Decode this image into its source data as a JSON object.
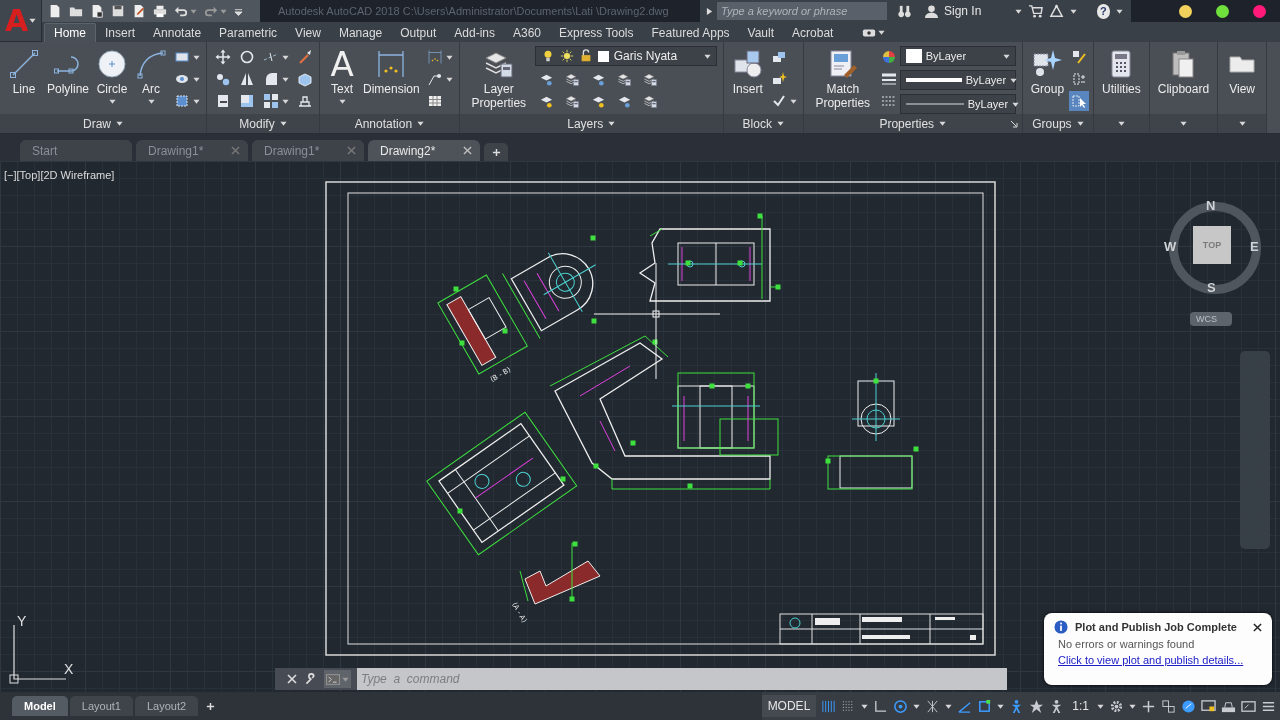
{
  "app_button": {
    "letter": "A"
  },
  "quick_access": [
    {
      "menu": false
    },
    {
      "menu": false
    },
    {
      "menu": false
    },
    {
      "menu": false
    },
    {
      "menu": false
    },
    {
      "menu": false
    },
    {
      "menu": true
    },
    {
      "menu": true
    }
  ],
  "title": "Autodesk AutoCAD 2018    C:\\Users\\Administrator\\Documents\\Lati    \\Drawing2.dwg",
  "search": {
    "placeholder": "Type a keyword or phrase"
  },
  "sign_in": "Sign In",
  "help": "?",
  "window_buttons": [
    {
      "color": "#f2d15c"
    },
    {
      "color": "#6fe03c"
    },
    {
      "color": "#ff1a7a"
    }
  ],
  "ribbon_tabs": [
    {
      "label": "Home",
      "selected": true
    },
    {
      "label": "Insert",
      "selected": false
    },
    {
      "label": "Annotate",
      "selected": false
    },
    {
      "label": "Parametric",
      "selected": false
    },
    {
      "label": "View",
      "selected": false
    },
    {
      "label": "Manage",
      "selected": false
    },
    {
      "label": "Output",
      "selected": false
    },
    {
      "label": "Add-ins",
      "selected": false
    },
    {
      "label": "A360",
      "selected": false
    },
    {
      "label": "Express Tools",
      "selected": false
    },
    {
      "label": "Featured Apps",
      "selected": false
    },
    {
      "label": "Vault",
      "selected": false
    },
    {
      "label": "Acrobat",
      "selected": false
    }
  ],
  "ribbon_panels": [
    {
      "title": "Draw",
      "items": [
        {
          "kind": "large",
          "label": "Line",
          "menu": false
        },
        {
          "kind": "large",
          "label": "Polyline",
          "menu": false
        },
        {
          "kind": "large",
          "label": "Circle",
          "menu": true
        },
        {
          "kind": "large",
          "label": "Arc",
          "menu": true
        },
        {
          "kind": "tools",
          "tools": [
            {
              "menu": true
            },
            {
              "menu": true
            },
            {
              "menu": true
            }
          ]
        }
      ]
    },
    {
      "title": "Modify",
      "items": [
        {
          "kind": "tools",
          "tools": [
            {
              "menu": false
            },
            {
              "menu": false
            },
            {
              "menu": false
            },
            {
              "menu": false
            },
            {
              "menu": false
            },
            {
              "menu": false
            },
            {
              "menu": true
            },
            {
              "menu": true
            },
            {
              "menu": true
            },
            {
              "menu": false
            },
            {
              "menu": false
            },
            {
              "menu": false
            }
          ]
        }
      ]
    },
    {
      "title": "Annotation",
      "items": [
        {
          "kind": "large",
          "glyph": "A",
          "label": "Text",
          "menu": true
        },
        {
          "kind": "large",
          "label": "Dimension",
          "menu": false
        },
        {
          "kind": "tools",
          "tools": [
            {
              "menu": true
            },
            {
              "menu": true
            },
            {
              "menu": false
            }
          ]
        }
      ]
    },
    {
      "title": "Layers",
      "items": [
        {
          "kind": "large",
          "label": "Layer Properties",
          "menu": false
        },
        {
          "kind": "layer-control",
          "value": "Garis Nyata"
        }
      ]
    },
    {
      "title": "Block",
      "items": [
        {
          "kind": "large",
          "label": "Insert",
          "menu": false
        },
        {
          "kind": "tools",
          "tools": [
            {
              "menu": false
            },
            {
              "menu": false
            },
            {
              "menu": true
            }
          ]
        }
      ]
    },
    {
      "title": "Properties",
      "launcher": true,
      "items": [
        {
          "kind": "large",
          "label": "Match Properties",
          "menu": false
        },
        {
          "kind": "tools"
        },
        {
          "kind": "dropdowns",
          "dropdowns": [
            {
              "kind": "color",
              "value": "ByLayer"
            },
            {
              "kind": "lineweight",
              "value": "ByLayer"
            },
            {
              "kind": "linetype",
              "value": "ByLayer"
            }
          ]
        }
      ]
    },
    {
      "title": "Groups",
      "items": [
        {
          "kind": "large",
          "label": "Group",
          "menu": false
        },
        {
          "kind": "tools",
          "tools": [
            {
              "on": false
            },
            {
              "on": false
            },
            {
              "on": true
            }
          ]
        }
      ]
    },
    {
      "items": [
        {
          "kind": "large",
          "label": "Utilities",
          "menu": false
        }
      ]
    },
    {
      "items": [
        {
          "kind": "large",
          "label": "Clipboard",
          "menu": false
        }
      ]
    },
    {
      "items": [
        {
          "kind": "large",
          "label": "View",
          "menu": false
        }
      ]
    }
  ],
  "doc_tabs": [
    {
      "label": "Start",
      "selected": false,
      "closable": false
    },
    {
      "label": "Drawing1*",
      "selected": false,
      "closable": true
    },
    {
      "label": "Drawing1*",
      "selected": false,
      "closable": true
    },
    {
      "label": "Drawing2*",
      "selected": true,
      "closable": true
    }
  ],
  "viewport_label": "[−][Top][2D Wireframe]",
  "nav_cube": {
    "north": "N",
    "west": "W",
    "face": "TOP",
    "east": "E",
    "south": "S",
    "ucs": "WCS"
  },
  "drawing": {
    "section_labels": [
      "(B - B)",
      "(A - A)"
    ]
  },
  "ucs_icon": {
    "y_label": "Y",
    "x_label": "X"
  },
  "command_line": {
    "placeholder": "Type  a  command"
  },
  "notification": {
    "title": "Plot and Publish Job Complete",
    "message": "No errors or warnings found",
    "link": "Click to view plot and publish details..."
  },
  "layout_tabs": [
    {
      "label": "Model",
      "selected": true
    },
    {
      "label": "Layout1",
      "selected": false
    },
    {
      "label": "Layout2",
      "selected": false
    }
  ],
  "status_bar": [
    {
      "kind": "text",
      "label": "MODEL",
      "menu": false
    },
    {
      "kind": "icon",
      "on": true,
      "menu": false
    },
    {
      "kind": "icon",
      "on": false,
      "menu": true
    },
    {
      "kind": "icon",
      "on": false,
      "menu": false
    },
    {
      "kind": "icon",
      "on": true,
      "menu": true
    },
    {
      "kind": "icon",
      "on": false,
      "menu": true
    },
    {
      "kind": "icon",
      "on": true,
      "menu": false
    },
    {
      "kind": "icon",
      "on": true,
      "menu": true
    },
    {
      "kind": "icon",
      "on": true,
      "menu": false
    },
    {
      "kind": "icon",
      "on": false,
      "menu": false
    },
    {
      "kind": "icon",
      "on": false,
      "menu": false
    },
    {
      "kind": "text",
      "label": "1:1",
      "menu": true
    },
    {
      "kind": "icon",
      "on": false,
      "menu": true
    },
    {
      "kind": "icon",
      "on": false,
      "menu": false
    },
    {
      "kind": "icon",
      "on": false,
      "menu": false
    },
    {
      "kind": "icon",
      "on": true,
      "menu": false
    },
    {
      "kind": "icon",
      "on": false,
      "menu": false
    },
    {
      "kind": "icon",
      "on": false,
      "menu": false
    },
    {
      "kind": "icon",
      "on": false,
      "menu": false
    },
    {
      "kind": "icon",
      "on": false,
      "menu": false
    }
  ]
}
